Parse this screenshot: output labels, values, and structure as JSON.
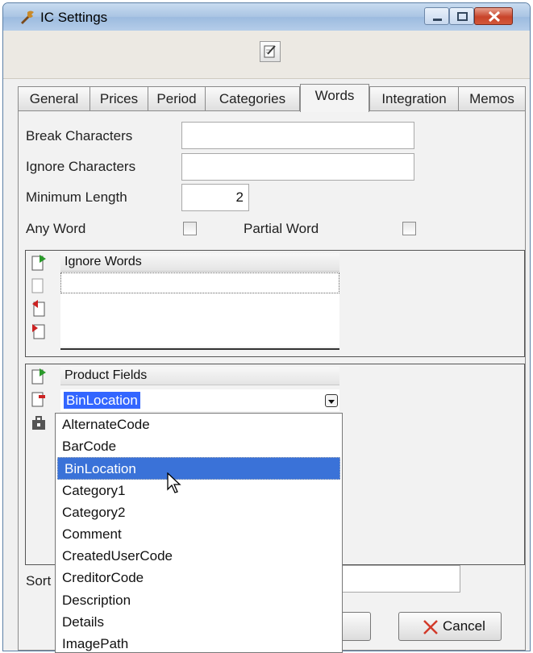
{
  "window": {
    "title": "IC Settings",
    "app_icon": "wrench-icon"
  },
  "toolbar": {
    "edit_icon": "edit-icon"
  },
  "tabs": [
    {
      "label": "General"
    },
    {
      "label": "Prices"
    },
    {
      "label": "Period"
    },
    {
      "label": "Categories"
    },
    {
      "label": "Words",
      "active": true
    },
    {
      "label": "Integration"
    },
    {
      "label": "Memos"
    }
  ],
  "form": {
    "break_characters": {
      "label": "Break Characters",
      "value": ""
    },
    "ignore_characters": {
      "label": "Ignore Characters",
      "value": ""
    },
    "minimum_length": {
      "label": "Minimum Length",
      "value": "2"
    },
    "any_word": {
      "label": "Any Word",
      "checked": false
    },
    "partial_word": {
      "label": "Partial Word",
      "checked": false
    }
  },
  "ignore_words": {
    "header": "Ignore Words",
    "rows": [
      ""
    ]
  },
  "product_fields": {
    "header": "Product Fields",
    "selected_value": "BinLocation",
    "options": [
      "AlternateCode",
      "BarCode",
      "BinLocation",
      "Category1",
      "Category2",
      "Comment",
      "CreatedUserCode",
      "CreditorCode",
      "Description",
      "Details",
      "ImagePath"
    ],
    "highlighted": "BinLocation"
  },
  "sort": {
    "label": "Sort"
  },
  "buttons": {
    "cancel": "Cancel"
  },
  "colors": {
    "selection": "#3366ff",
    "titlebar": "#a9c4e3",
    "cancel_x": "#d23a2a"
  }
}
